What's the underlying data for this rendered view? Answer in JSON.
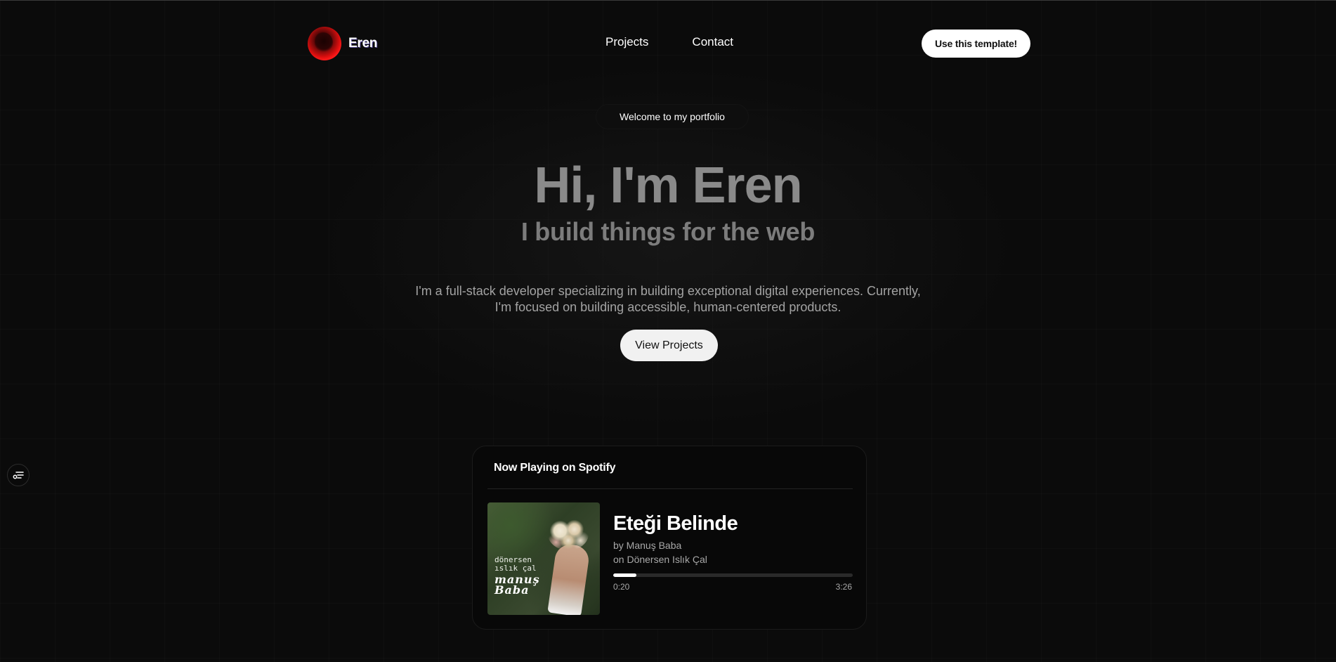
{
  "nav": {
    "brand_name": "Eren",
    "links": [
      "Projects",
      "Contact"
    ],
    "cta_label": "Use this template!"
  },
  "hero": {
    "badge": "Welcome to my portfolio",
    "title": "Hi, I'm Eren",
    "subtitle": "I build things for the web",
    "description_line1": "I'm a full-stack developer specializing in building exceptional digital experiences. Currently,",
    "description_line2": "I'm focused on building accessible, human-centered products.",
    "button_label": "View Projects"
  },
  "spotify": {
    "heading": "Now Playing on Spotify",
    "track": "Eteği Belinde",
    "artist_line": "by Manuş Baba",
    "album_line": "on Dönersen Islık Çal",
    "elapsed": "0:20",
    "duration": "3:26",
    "progress_fraction": 0.097,
    "cover_text_line1": "dönersen",
    "cover_text_line2": "ıslık çal",
    "cover_script_line1": "manuş",
    "cover_script_line2": "Baba"
  },
  "side_button": {
    "icon": "settings-sliders-icon"
  },
  "colors": {
    "background": "#0b0b0b",
    "accent_red": "#d80e0e",
    "button_bg": "#ffffff"
  }
}
